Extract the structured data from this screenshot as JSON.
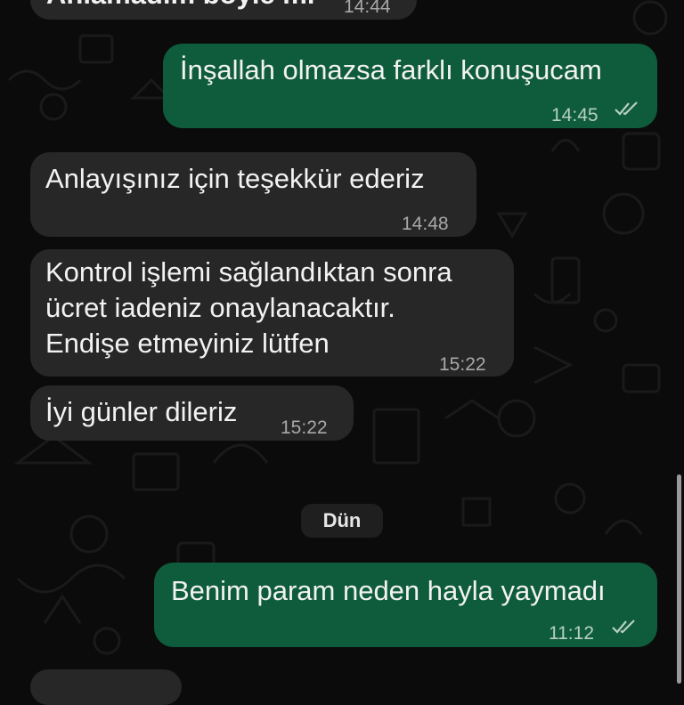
{
  "chat": {
    "messages": [
      {
        "text": "Anlamadım boyle mi",
        "time": "14:44"
      },
      {
        "text": "İnşallah olmazsa farklı konuşucam",
        "time": "14:45",
        "status": "read"
      },
      {
        "text": "Anlayışınız için teşekkür ederiz",
        "time": "14:48"
      },
      {
        "lines": [
          "Kontrol işlemi sağlandıktan sonra",
          "ücret iadeniz onaylanacaktır.",
          "Endişe etmeyiniz lütfen"
        ],
        "time": "15:22"
      },
      {
        "text": "İyi günler dileriz",
        "time": "15:22"
      },
      {
        "text": "Benim param neden hayla yaymadı",
        "time": "11:12",
        "status": "read"
      }
    ],
    "date_separator": "Dün"
  },
  "colors": {
    "background": "#0b0b0b",
    "incoming_bubble": "#272727",
    "outgoing_bubble": "#0f5c3c",
    "read_ticks": "#b6cfc3"
  },
  "icons": [
    "double-check-icon"
  ]
}
